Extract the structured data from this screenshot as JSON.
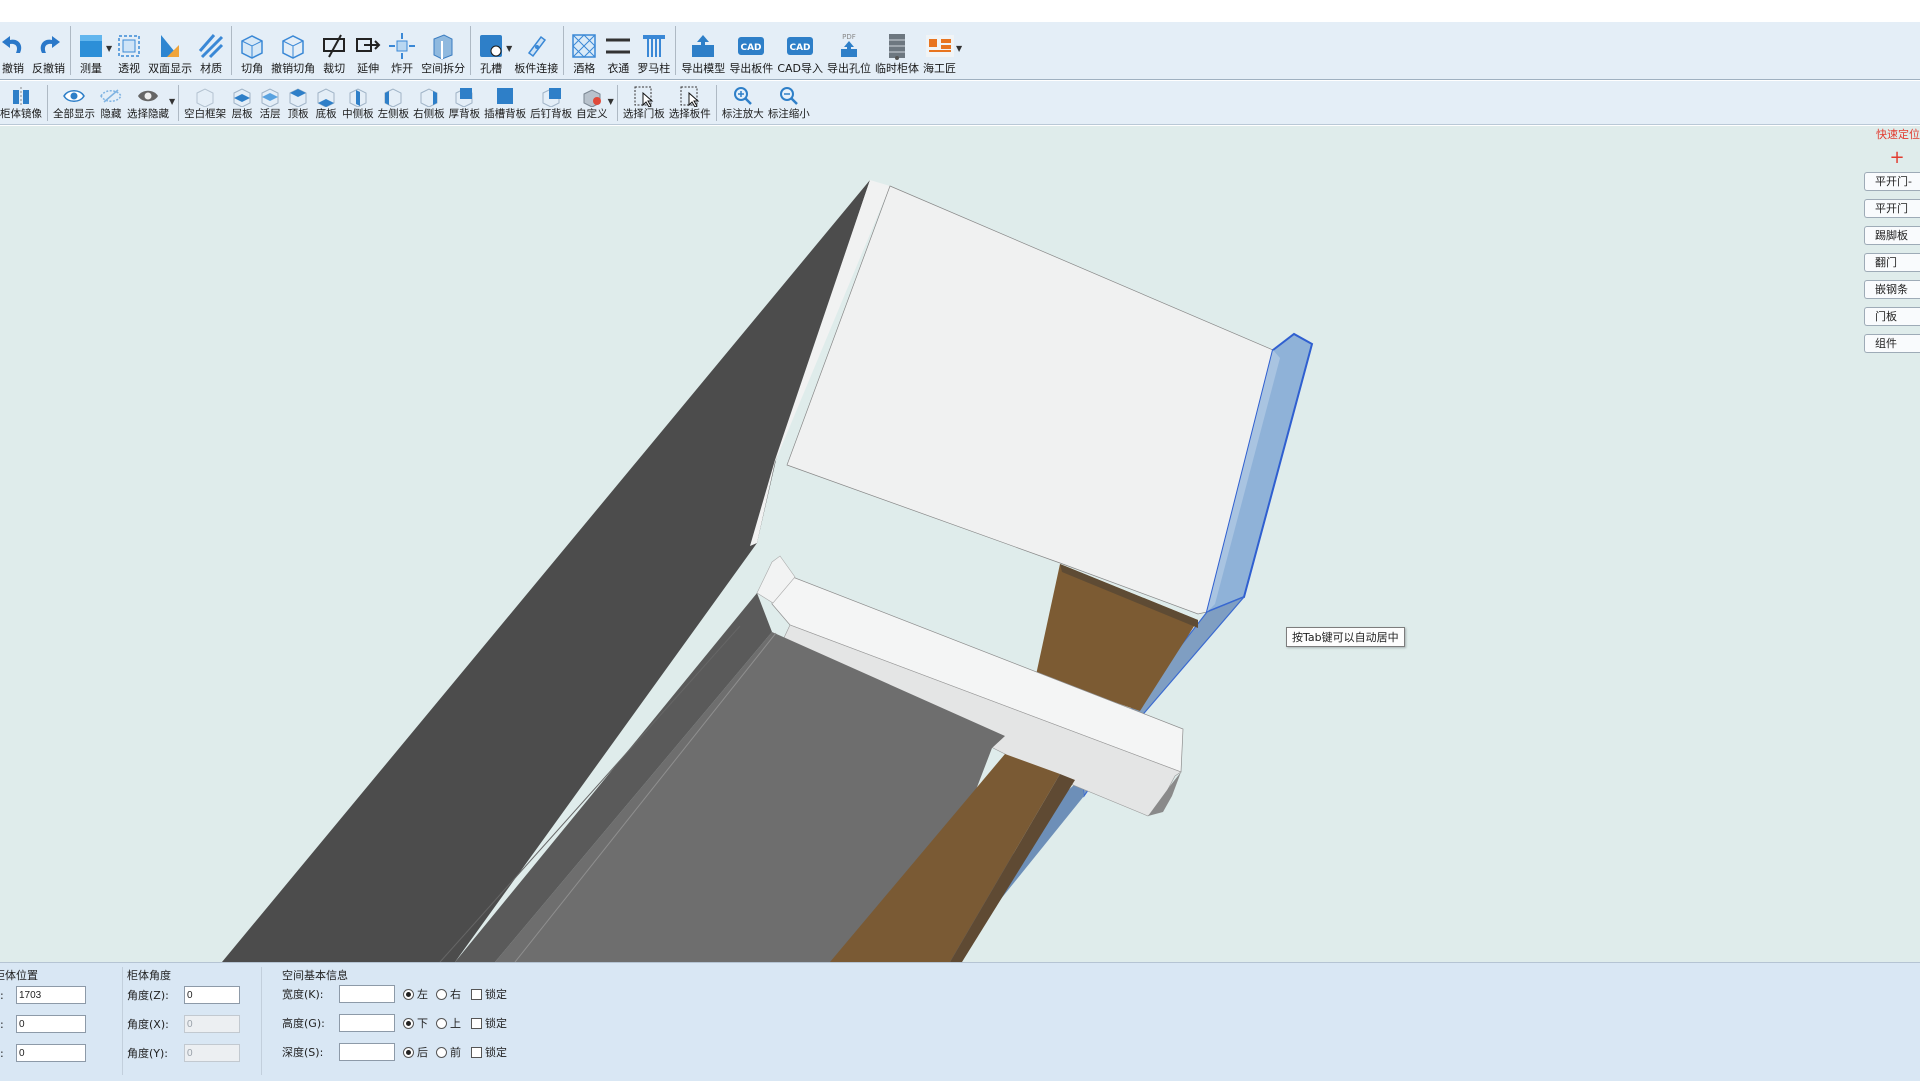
{
  "toolbar_main": [
    {
      "label": "撤销",
      "icon": "undo-icon"
    },
    {
      "label": "反撤销",
      "icon": "redo-icon"
    },
    {
      "label": "测量",
      "icon": "measure-icon"
    },
    {
      "label": "透视",
      "icon": "perspective-icon"
    },
    {
      "label": "双面显示",
      "icon": "double-side-icon"
    },
    {
      "label": "材质",
      "icon": "material-icon"
    },
    {
      "label": "切角",
      "icon": "chamfer-icon"
    },
    {
      "label": "撤销切角",
      "icon": "undo-chamfer-icon"
    },
    {
      "label": "裁切",
      "icon": "trim-icon"
    },
    {
      "label": "延伸",
      "icon": "extend-icon"
    },
    {
      "label": "炸开",
      "icon": "explode-icon"
    },
    {
      "label": "空间拆分",
      "icon": "split-space-icon"
    },
    {
      "label": "孔槽",
      "icon": "hole-slot-icon"
    },
    {
      "label": "板件连接",
      "icon": "panel-connect-icon"
    },
    {
      "label": "酒格",
      "icon": "wine-rack-icon"
    },
    {
      "label": "衣通",
      "icon": "hanging-rod-icon"
    },
    {
      "label": "罗马柱",
      "icon": "roman-column-icon"
    },
    {
      "label": "导出模型",
      "icon": "export-model-icon"
    },
    {
      "label": "导出板件",
      "icon": "export-panel-cad-icon"
    },
    {
      "label": "CAD导入",
      "icon": "cad-import-icon"
    },
    {
      "label": "导出孔位",
      "icon": "export-holes-pdf-icon"
    },
    {
      "label": "临时柜体",
      "icon": "temp-cabinet-icon"
    },
    {
      "label": "海工匠",
      "icon": "brand-logo-icon"
    }
  ],
  "toolbar_secondary": [
    {
      "label": "柜体镜像",
      "icon": "mirror-icon"
    },
    {
      "label": "全部显示",
      "icon": "show-all-icon"
    },
    {
      "label": "隐藏",
      "icon": "hide-icon"
    },
    {
      "label": "选择隐藏",
      "icon": "select-hide-icon"
    },
    {
      "label": "空白框架",
      "icon": "blank-frame-icon"
    },
    {
      "label": "层板",
      "icon": "shelf-icon"
    },
    {
      "label": "活层",
      "icon": "movable-shelf-icon"
    },
    {
      "label": "顶板",
      "icon": "top-panel-icon"
    },
    {
      "label": "底板",
      "icon": "bottom-panel-icon"
    },
    {
      "label": "中侧板",
      "icon": "middle-side-panel-icon"
    },
    {
      "label": "左侧板",
      "icon": "left-side-panel-icon"
    },
    {
      "label": "右侧板",
      "icon": "right-side-panel-icon"
    },
    {
      "label": "厚背板",
      "icon": "thick-back-panel-icon"
    },
    {
      "label": "插槽背板",
      "icon": "slot-back-panel-icon"
    },
    {
      "label": "后钉背板",
      "icon": "nailed-back-panel-icon"
    },
    {
      "label": "自定义",
      "icon": "custom-icon"
    },
    {
      "label": "选择门板",
      "icon": "select-door-icon"
    },
    {
      "label": "选择板件",
      "icon": "select-panel-icon"
    },
    {
      "label": "标注放大",
      "icon": "zoom-in-dimension-icon"
    },
    {
      "label": "标注缩小",
      "icon": "zoom-out-dimension-icon"
    }
  ],
  "quick_panel": {
    "title": "快速定位",
    "add": "+",
    "buttons": [
      "平开门-",
      "平开门",
      "踢脚板",
      "翻门",
      "嵌钢条",
      "门板",
      "组件"
    ]
  },
  "tooltip": "按Tab键可以自动居中",
  "props": {
    "position": {
      "title": "柜体位置",
      "rows": [
        {
          "label": ":",
          "value": "1703"
        },
        {
          "label": ":",
          "value": "0"
        },
        {
          "label": ":",
          "value": "0"
        }
      ]
    },
    "angle": {
      "title": "柜体角度",
      "rows": [
        {
          "label": "角度(Z):",
          "value": "0",
          "disabled": false
        },
        {
          "label": "角度(X):",
          "value": "0",
          "disabled": true
        },
        {
          "label": "角度(Y):",
          "value": "0",
          "disabled": true
        }
      ]
    },
    "space": {
      "title": "空间基本信息",
      "rows": [
        {
          "label": "宽度(K):",
          "value": "",
          "opt1": "左",
          "opt2": "右",
          "lock": "锁定"
        },
        {
          "label": "高度(G):",
          "value": "",
          "opt1": "下",
          "opt2": "上",
          "lock": "锁定"
        },
        {
          "label": "深度(S):",
          "value": "",
          "opt1": "后",
          "opt2": "前",
          "lock": "锁定"
        }
      ]
    }
  },
  "colors": {
    "toolbar_bg": "#e4eef7",
    "viewport_bg": "#dfeceb",
    "props_bg": "#d9e7f4",
    "dark_panel": "#4d4d4d",
    "wood": "#7a5a34",
    "selected_edge": "#3a66d6",
    "quick_accent": "#e23b2f"
  }
}
